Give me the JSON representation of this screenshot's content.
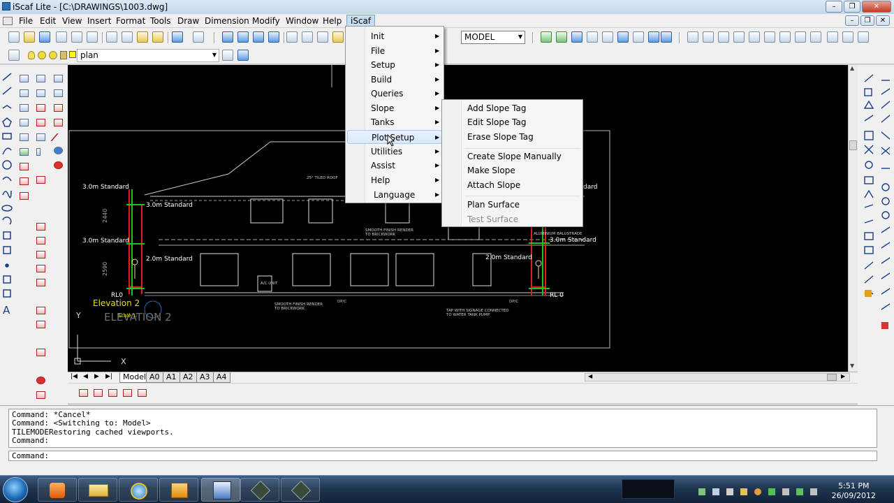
{
  "window": {
    "title": "iScaf Lite - [C:\\DRAWINGS\\1003.dwg]",
    "controls": [
      "–",
      "❐",
      "✕"
    ],
    "doc_controls": [
      "–",
      "❐",
      "✕"
    ]
  },
  "menubar": {
    "items": [
      "File",
      "Edit",
      "View",
      "Insert",
      "Format",
      "Tools",
      "Draw",
      "Dimension",
      "Modify",
      "Window",
      "Help",
      "iScaf"
    ]
  },
  "toolbar": {
    "space_select": "MODEL",
    "layer_select": "plan"
  },
  "iscaf_menu": {
    "items": [
      "Init",
      "File",
      "Setup",
      "Build",
      "Queries",
      "Slope",
      "Tanks",
      "Plot Setup",
      "Utilities",
      "Assist",
      "Help",
      "Language"
    ],
    "highlighted": "Plot Setup"
  },
  "slope_submenu": {
    "groups": [
      [
        "Add Slope Tag",
        "Edit Slope Tag",
        "Erase Slope Tag"
      ],
      [
        "Create Slope Manually",
        "Make Slope",
        "Attach Slope"
      ],
      [
        "Plan Surface",
        "Test Surface"
      ]
    ],
    "disabled": [
      "Test Surface"
    ]
  },
  "drawing": {
    "labels": {
      "std_3m_a": "3.0m Standard",
      "std_3m_b": "3.0m Standard",
      "std_3m_c": "3.0m Standard",
      "std_2m_a": "2.0m Standard",
      "std_3m_d": "3.0m Standard",
      "std_2m_b": "2.0m Standard",
      "std_right_cut": "dard",
      "dim_2440": "2440",
      "dim_2590": "2590",
      "rl0_left": "RL0",
      "rl0_right": "RL 0",
      "elevation_title": "Elevation 2",
      "elevation_big": "ELEVATION 2",
      "scale": "Scale 1:",
      "roof_note": "25° TILED ROOF",
      "render_note_1": "SMOOTH FINISH RENDER",
      "render_note_2": "TO BRICKWORK",
      "render_note_3": "SMOOTH FINISH RENDER",
      "render_note_4": "TO BRICKWORK",
      "balustrade_1": "ALUMINIUM BALUSTRADE",
      "tap_note_1": "TAP WITH SIGNAGE CONNECTED",
      "tap_note_2": "TO WATER TANK PUMP",
      "ac_unit": "A/C UNIT",
      "dp_1": "DP/C",
      "dp_2": "DP/C",
      "y_axis": "Y",
      "x_axis": "X"
    }
  },
  "layout_tabs": [
    "Model",
    "A0",
    "A1",
    "A2",
    "A3",
    "A4"
  ],
  "command": {
    "history": [
      "Command: *Cancel*",
      "Command:  <Switching to: Model>",
      "TILEMODERestoring cached viewports.",
      "Command:"
    ],
    "prompt": "Command:"
  },
  "taskbar": {
    "time": "5:51 PM",
    "date": "26/09/2012"
  }
}
